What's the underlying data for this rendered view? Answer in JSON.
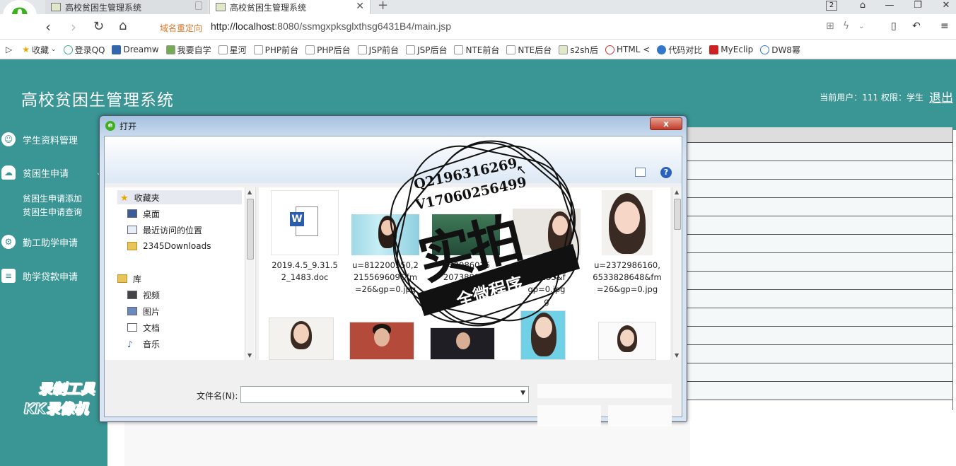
{
  "browser": {
    "tabs": [
      {
        "label": "高校贫困生管理系统"
      },
      {
        "label": "高校贫困生管理系统"
      }
    ],
    "tab_count": "2",
    "redirect_label": "域名重定向",
    "url_host": "http://localhost",
    "url_rest": ":8080/ssmgxpksglxthsg6431B4/main.jsp",
    "bookmarks": [
      {
        "label": "收藏"
      },
      {
        "label": "登录QQ"
      },
      {
        "label": "Dreamw"
      },
      {
        "label": "我要自学"
      },
      {
        "label": "星河"
      },
      {
        "label": "PHP前台"
      },
      {
        "label": "PHP后台"
      },
      {
        "label": "JSP前台"
      },
      {
        "label": "JSP后台"
      },
      {
        "label": "NTE前台"
      },
      {
        "label": "NTE后台"
      },
      {
        "label": "s2sh后"
      },
      {
        "label": "HTML <"
      },
      {
        "label": "代码对比"
      },
      {
        "label": "MyEclip"
      },
      {
        "label": "DW8幂"
      }
    ]
  },
  "page": {
    "title": "高校贫困生管理系统",
    "user_info": "当前用户：111  权限：学生",
    "logout": "退出",
    "colors": {
      "teal": "#3a9595"
    }
  },
  "sidebar": {
    "menus": [
      {
        "label": "学生资料管理",
        "icon": "user-icon"
      },
      {
        "label": "贫困生申请",
        "icon": "cloud-icon"
      },
      {
        "label": "勤工助学申请",
        "icon": "gear-icon"
      },
      {
        "label": "助学贷款申请",
        "icon": "stack-icon"
      }
    ],
    "submenu": [
      {
        "label": "贫困生申请添加"
      },
      {
        "label": "贫困生申请查询"
      }
    ]
  },
  "dialog": {
    "title": "打开",
    "close": "x",
    "nav": {
      "favorites": "收藏夹",
      "items": [
        "桌面",
        "最近访问的位置",
        "2345Downloads"
      ],
      "library": "库",
      "lib_items": [
        "视频",
        "图片",
        "文档",
        "音乐"
      ]
    },
    "files": [
      {
        "name": "2019.4.5_9.31.52_1483.doc",
        "line1": "2019.4.5_9.31.5",
        "line2": "2_1483.doc"
      },
      {
        "line1": "u=812200350,2",
        "line2": "215569609&fm",
        "line3": "=26&gp=0.jpg"
      },
      {
        "line1": "u=2986015",
        "line2": "2073888&f",
        "line3": "m=26&"
      },
      {
        "line1": "u=1789485170,",
        "line2": "1 2233&f",
        "line3": "gp=0.jpg",
        "line4": "g"
      },
      {
        "line1": "u=2372986160,",
        "line2": "6533828648&fm",
        "line3": "=26&gp=0.jpg"
      }
    ],
    "filename_label": "文件名(N):",
    "filename_value": ""
  },
  "overlay": {
    "qq": "Q2196316269",
    "vx": "V17060256499",
    "stamp_main": "实拍",
    "stamp_sub": "全微程序",
    "recorder_line1": "录制工具",
    "recorder_line2": "KK录像机"
  }
}
